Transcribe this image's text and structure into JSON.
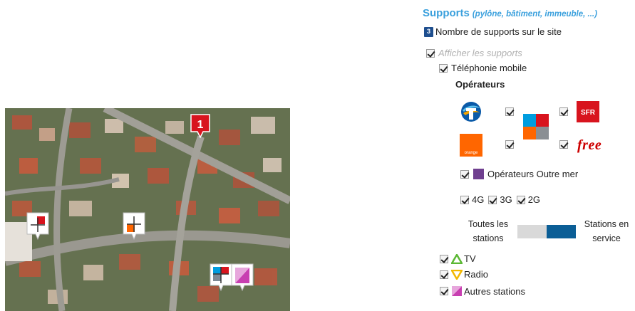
{
  "panel": {
    "title": "Supports",
    "subtitle": "(pylône, bâtiment, immeuble, ...)",
    "count_badge": "3",
    "count_label": "Nombre de supports sur le site",
    "show_supports_label": "Afficher les supports",
    "mobile_label": "Téléphonie mobile",
    "operators_title": "Opérateurs",
    "operators": [
      {
        "name": "Bouygues",
        "icon": "bouygues-logo-icon",
        "checked": true
      },
      {
        "name": "SFR",
        "icon": "sfr-logo-icon",
        "checked": true,
        "text": "SFR"
      },
      {
        "name": "Orange",
        "icon": "orange-logo-icon",
        "checked": true,
        "text": "orange"
      },
      {
        "name": "Free",
        "icon": "free-logo-icon",
        "checked": true,
        "text": "free"
      }
    ],
    "multi_operator_icon": "multi-operator-icon",
    "overseas_label": "Opérateurs Outre mer",
    "techs": [
      "4G",
      "3G",
      "2G"
    ],
    "toggle": {
      "left_line1": "Toutes les",
      "left_line2": "stations",
      "right_line1": "Stations en",
      "right_line2": "service",
      "selected": "Stations en service"
    },
    "layers": [
      {
        "label": "TV",
        "icon": "tv-triangle-icon",
        "color": "#5bb833"
      },
      {
        "label": "Radio",
        "icon": "radio-triangle-icon",
        "color": "#f2b700"
      },
      {
        "label": "Autres stations",
        "icon": "other-stations-icon",
        "color": "#c83fb1"
      }
    ]
  },
  "map": {
    "site_marker_label": "1",
    "colors": {
      "marker_red": "#d8141e",
      "sfr_red": "#d8141e",
      "orange": "#ff6600",
      "bouygues_blue": "#009ddf",
      "free_purple": "#c83fb1"
    }
  }
}
